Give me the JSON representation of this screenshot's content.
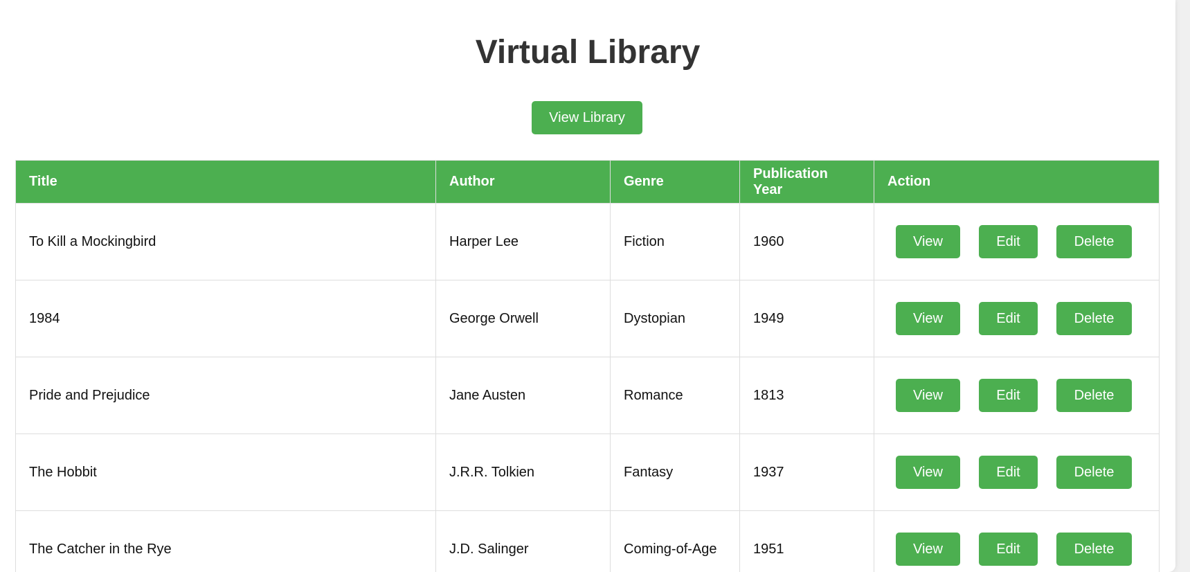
{
  "page": {
    "title": "Virtual Library",
    "view_library_label": "View Library"
  },
  "table": {
    "headers": [
      "Title",
      "Author",
      "Genre",
      "Publication Year",
      "Action"
    ],
    "rows": [
      {
        "title": "To Kill a Mockingbird",
        "author": "Harper Lee",
        "genre": "Fiction",
        "year": "1960"
      },
      {
        "title": "1984",
        "author": "George Orwell",
        "genre": "Dystopian",
        "year": "1949"
      },
      {
        "title": "Pride and Prejudice",
        "author": "Jane Austen",
        "genre": "Romance",
        "year": "1813"
      },
      {
        "title": "The Hobbit",
        "author": "J.R.R. Tolkien",
        "genre": "Fantasy",
        "year": "1937"
      },
      {
        "title": "The Catcher in the Rye",
        "author": "J.D. Salinger",
        "genre": "Coming-of-Age",
        "year": "1951"
      }
    ],
    "action_labels": {
      "view": "View",
      "edit": "Edit",
      "delete": "Delete"
    }
  },
  "colors": {
    "accent": "#4caf50",
    "heading_text": "#333333",
    "border": "#dddddd"
  }
}
